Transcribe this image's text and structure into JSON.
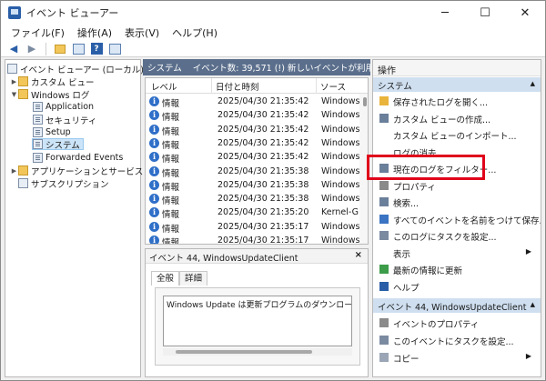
{
  "window": {
    "title": "イベント ビューアー"
  },
  "window_controls": {
    "minimize": "─",
    "maximize": "☐",
    "close": "✕"
  },
  "menu": [
    "ファイル(F)",
    "操作(A)",
    "表示(V)",
    "ヘルプ(H)"
  ],
  "toolbar": {
    "back": "◀",
    "forward": "▶",
    "help": "?"
  },
  "tree": {
    "root": "イベント ビューアー (ローカル)",
    "custom_views": "カスタム ビュー",
    "windows_logs": "Windows ログ",
    "application": "Application",
    "security": "セキュリティ",
    "setup": "Setup",
    "system": "システム",
    "forwarded": "Forwarded Events",
    "apps_services": "アプリケーションとサービス ログ",
    "subscriptions": "サブスクリプション"
  },
  "center": {
    "log_name": "システム",
    "event_summary": "イベント数: 39,571 (!) 新しいイベントが利用可能です",
    "columns": [
      "レベル",
      "日付と時刻",
      "ソース"
    ],
    "rows": [
      {
        "level": "情報",
        "datetime": "2025/04/30 21:35:42",
        "source": "Windows"
      },
      {
        "level": "情報",
        "datetime": "2025/04/30 21:35:42",
        "source": "Windows"
      },
      {
        "level": "情報",
        "datetime": "2025/04/30 21:35:42",
        "source": "Windows"
      },
      {
        "level": "情報",
        "datetime": "2025/04/30 21:35:42",
        "source": "Windows"
      },
      {
        "level": "情報",
        "datetime": "2025/04/30 21:35:42",
        "source": "Windows"
      },
      {
        "level": "情報",
        "datetime": "2025/04/30 21:35:38",
        "source": "Windows"
      },
      {
        "level": "情報",
        "datetime": "2025/04/30 21:35:38",
        "source": "Windows"
      },
      {
        "level": "情報",
        "datetime": "2025/04/30 21:35:38",
        "source": "Windows"
      },
      {
        "level": "情報",
        "datetime": "2025/04/30 21:35:20",
        "source": "Kernel-G"
      },
      {
        "level": "情報",
        "datetime": "2025/04/30 21:35:17",
        "source": "Windows"
      },
      {
        "level": "情報",
        "datetime": "2025/04/30 21:35:17",
        "source": "Windows"
      }
    ]
  },
  "detail": {
    "header": "イベント 44, WindowsUpdateClient",
    "close": "×",
    "tabs": [
      "全般",
      "詳細"
    ],
    "message": "Windows Update は更新プログラムのダウンロードを開始し"
  },
  "actions": {
    "title": "操作",
    "section1": "システム",
    "items1": [
      "保存されたログを開く...",
      "カスタム ビューの作成...",
      "カスタム ビューのインポート...",
      "ログの消去...",
      "現在のログをフィルター...",
      "プロパティ",
      "検索...",
      "すべてのイベントを名前をつけて保存...",
      "このログにタスクを設定...",
      "表示",
      "最新の情報に更新",
      "ヘルプ"
    ],
    "section2": "イベント 44, WindowsUpdateClient",
    "items2": [
      "イベントのプロパティ",
      "このイベントにタスクを設定...",
      "コピー"
    ]
  },
  "colors": {
    "accent": "#2f6fc8",
    "header_bg": "#5b6f8c",
    "section_bg": "#cfdff0",
    "highlight": "#e0001b"
  }
}
